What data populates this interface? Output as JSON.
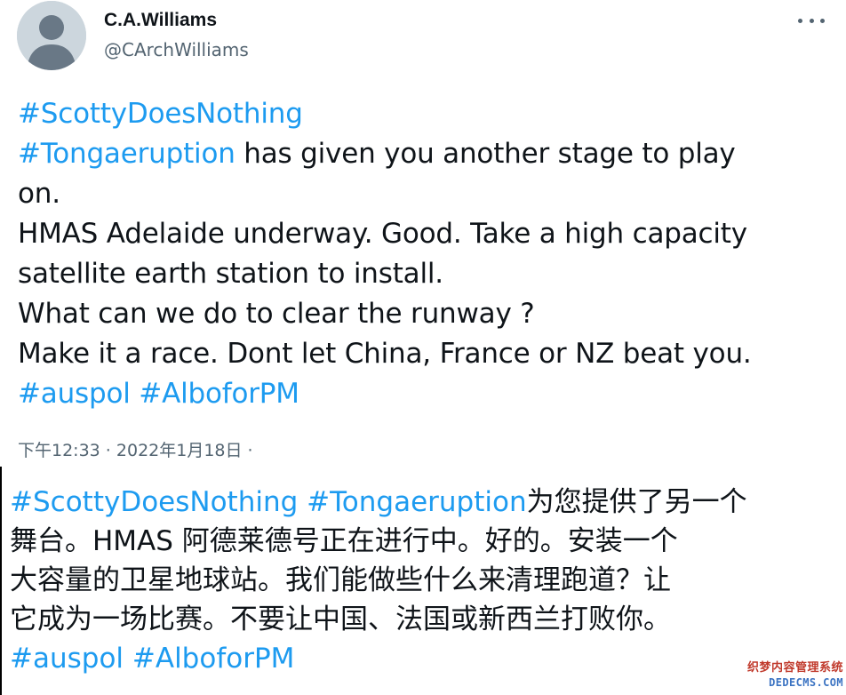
{
  "tweet": {
    "author_name": "C.A.Williams",
    "author_handle": "@CArchWilliams",
    "more_icon": "more-horizontal-icon",
    "avatar_icon": "default-avatar-icon",
    "lines": [
      [
        {
          "text": "#ScottyDoesNothing",
          "hashtag": true
        }
      ],
      [
        {
          "text": " #Tongaeruption",
          "hashtag": true
        },
        {
          "text": " has given you another stage to play",
          "hashtag": false
        }
      ],
      [
        {
          "text": "on.",
          "hashtag": false
        }
      ],
      [
        {
          "text": "HMAS Adelaide underway. Good. Take a high capacity",
          "hashtag": false
        }
      ],
      [
        {
          "text": "satellite earth station to install.",
          "hashtag": false
        }
      ],
      [
        {
          "text": "What can we do to clear the runway ?",
          "hashtag": false
        }
      ],
      [
        {
          "text": "Make it a race. Dont let China, France or NZ beat you.",
          "hashtag": false
        }
      ],
      [
        {
          "text": "#auspol",
          "hashtag": true
        },
        {
          "text": " ",
          "hashtag": false
        },
        {
          "text": "#AlboforPM",
          "hashtag": true
        }
      ]
    ],
    "timestamp_time": "下午12:33",
    "timestamp_sep": " · ",
    "timestamp_date": "2022年1月18日",
    "timestamp_trail": " ·"
  },
  "translation": {
    "lines": [
      [
        {
          "text": "#ScottyDoesNothing",
          "hashtag": true
        },
        {
          "text": " ",
          "hashtag": false
        },
        {
          "text": "#Tongaeruption",
          "hashtag": true
        },
        {
          "text": "为您提供了另一个",
          "hashtag": false
        }
      ],
      [
        {
          "text": "舞台。HMAS 阿德莱德号正在进行中。好的。安装一个",
          "hashtag": false
        }
      ],
      [
        {
          "text": "大容量的卫星地球站。我们能做些什么来清理跑道？让",
          "hashtag": false
        }
      ],
      [
        {
          "text": "它成为一场比赛。不要让中国、法国或新西兰打败你。",
          "hashtag": false
        }
      ],
      [
        {
          "text": "#auspol",
          "hashtag": true
        },
        {
          "text": " ",
          "hashtag": false
        },
        {
          "text": "#AlboforPM",
          "hashtag": true
        }
      ]
    ]
  },
  "watermark": {
    "cn": "织梦内容管理系统",
    "en": "DEDECMS.COM"
  },
  "colors": {
    "hashtag": "#1d9bf0",
    "text": "#0f1419",
    "secondary": "#536471"
  }
}
